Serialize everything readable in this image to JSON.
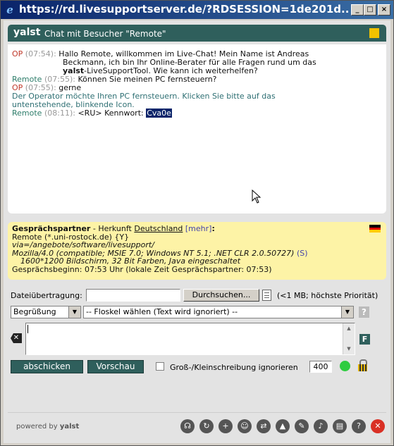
{
  "window": {
    "title": "https://rd.livesupportserver.de/?RDSESSION=1de201d...",
    "minimize": "_",
    "maximize": "□",
    "close": "×"
  },
  "header": {
    "brand": "yalst",
    "title": "Chat mit Besucher \"Remote\""
  },
  "chat": {
    "m1_sender": "OP",
    "m1_time": "(07:54):",
    "m1_text": "Hallo Remote, willkommen im Live-Chat! Mein Name ist Andreas",
    "m1_text2": "Beckmann, ich bin Ihr Online-Berater für alle Fragen rund um das",
    "m1_bold": "yalst",
    "m1_text3": "-LiveSupportTool. Wie kann ich weiterhelfen?",
    "m2_sender": "Remote",
    "m2_time": "(07:55):",
    "m2_text": "Können Sie meinen PC fernsteuern?",
    "m3_sender": "OP",
    "m3_time": "(07:55):",
    "m3_text": "gerne",
    "m4_text": "Der Operator möchte Ihren PC fernsteuern. Klicken Sie bitte auf das",
    "m4_text2": "untenstehende, blinkende Icon.",
    "m5_sender": "Remote",
    "m5_time": "(08:11):",
    "m5_text": "<RU> Kennwort:",
    "m5_selected": "Cva0e"
  },
  "info": {
    "label": "Gesprächspartner",
    "origin_prefix": " - Herkunft ",
    "country": "Deutschland",
    "more": "[mehr]",
    "colon": ":",
    "host": "Remote (*.uni-rostock.de) {Y}",
    "via": "via=/angebote/software/livesupport/",
    "ua": "Mozilla/4.0 (compatible; MSIE 7.0; Windows NT 5.1; .NET CLR 2.0.50727)",
    "ua_s": "(S)",
    "screen": "1600*1200 Bildschirm, 32 Bit Farben, Java eingeschaltet",
    "start": "Gesprächsbeginn: 07:53 Uhr (lokale Zeit Gesprächspartner: 07:53)"
  },
  "controls": {
    "file_label": "Dateiübertragung:",
    "browse": "Durchsuchen...",
    "file_note": "(<1 MB; höchste Priorität)",
    "greeting": "Begrüßung",
    "phrase": "-- Floskel wählen (Text wird ignoriert) --",
    "help": "?",
    "f_badge": "F",
    "send": "abschicken",
    "preview": "Vorschau",
    "case_label": "Groß-/Kleinschreibung ignorieren",
    "count": "400"
  },
  "footer": {
    "powered": "powered by ",
    "powered_brand": "yalst"
  }
}
